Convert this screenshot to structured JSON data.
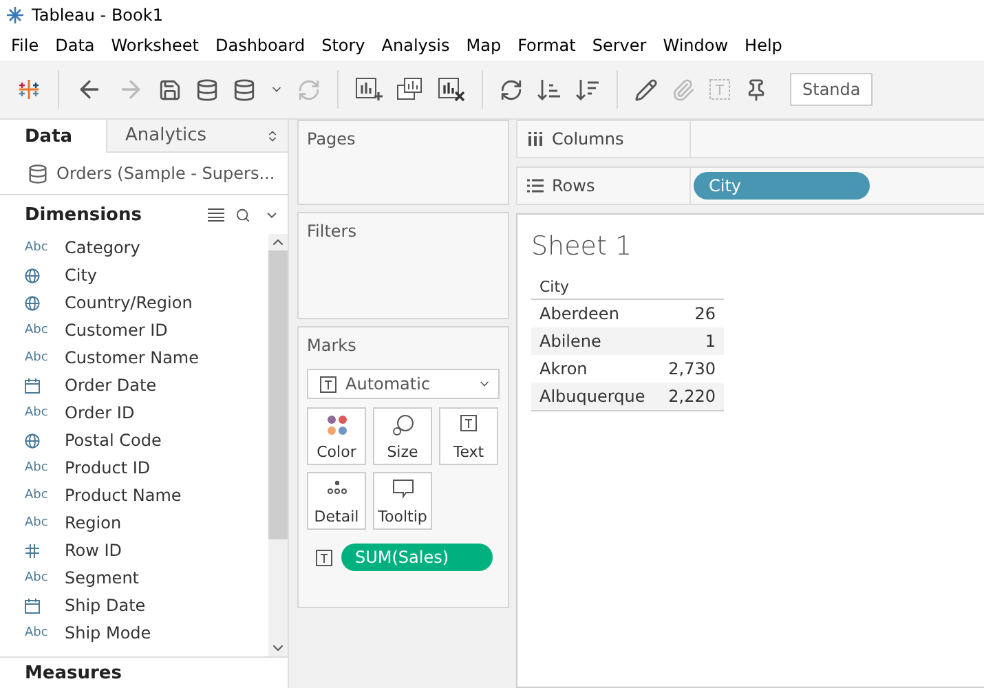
{
  "window": {
    "title": "Tableau - Book1"
  },
  "menu": [
    "File",
    "Data",
    "Worksheet",
    "Dashboard",
    "Story",
    "Analysis",
    "Map",
    "Format",
    "Server",
    "Window",
    "Help"
  ],
  "toolbar": {
    "fit_dropdown": "Standa"
  },
  "side_tabs": [
    {
      "label": "Data",
      "selected": true
    },
    {
      "label": "Analytics",
      "selected": false
    }
  ],
  "data_source": "Orders (Sample - Supers...",
  "dimensions": {
    "title": "Dimensions",
    "fields": [
      {
        "kind": "string",
        "icon_text": "Abc",
        "name": "Category"
      },
      {
        "kind": "geo",
        "name": "City"
      },
      {
        "kind": "geo",
        "name": "Country/Region"
      },
      {
        "kind": "string",
        "icon_text": "Abc",
        "name": "Customer ID"
      },
      {
        "kind": "string",
        "icon_text": "Abc",
        "name": "Customer Name"
      },
      {
        "kind": "date",
        "name": "Order Date"
      },
      {
        "kind": "string",
        "icon_text": "Abc",
        "name": "Order ID"
      },
      {
        "kind": "geo",
        "name": "Postal Code"
      },
      {
        "kind": "string",
        "icon_text": "Abc",
        "name": "Product ID"
      },
      {
        "kind": "string",
        "icon_text": "Abc",
        "name": "Product Name"
      },
      {
        "kind": "string",
        "icon_text": "Abc",
        "name": "Region"
      },
      {
        "kind": "number",
        "name": "Row ID"
      },
      {
        "kind": "string",
        "icon_text": "Abc",
        "name": "Segment"
      },
      {
        "kind": "date",
        "name": "Ship Date"
      },
      {
        "kind": "string",
        "icon_text": "Abc",
        "name": "Ship Mode"
      }
    ]
  },
  "measures": {
    "title": "Measures"
  },
  "cards": {
    "pages": "Pages",
    "filters": "Filters",
    "marks": {
      "title": "Marks",
      "mark_type": "Automatic",
      "buttons": [
        {
          "kind": "color",
          "label": "Color"
        },
        {
          "kind": "size",
          "label": "Size"
        },
        {
          "kind": "text",
          "label": "Text"
        },
        {
          "kind": "detail",
          "label": "Detail"
        },
        {
          "kind": "tooltip",
          "label": "Tooltip"
        }
      ],
      "pill": "SUM(Sales)"
    }
  },
  "shelves": [
    {
      "kind": "columns",
      "label": "Columns"
    },
    {
      "kind": "rows",
      "label": "Rows",
      "pills": [
        "City"
      ]
    }
  ],
  "sheet": {
    "title": "Sheet 1",
    "header": "City",
    "rows": [
      {
        "city": "Aberdeen",
        "value": "26"
      },
      {
        "city": "Abilene",
        "value": "1"
      },
      {
        "city": "Akron",
        "value": "2,730"
      },
      {
        "city": "Albuquerque",
        "value": "2,220"
      }
    ]
  }
}
